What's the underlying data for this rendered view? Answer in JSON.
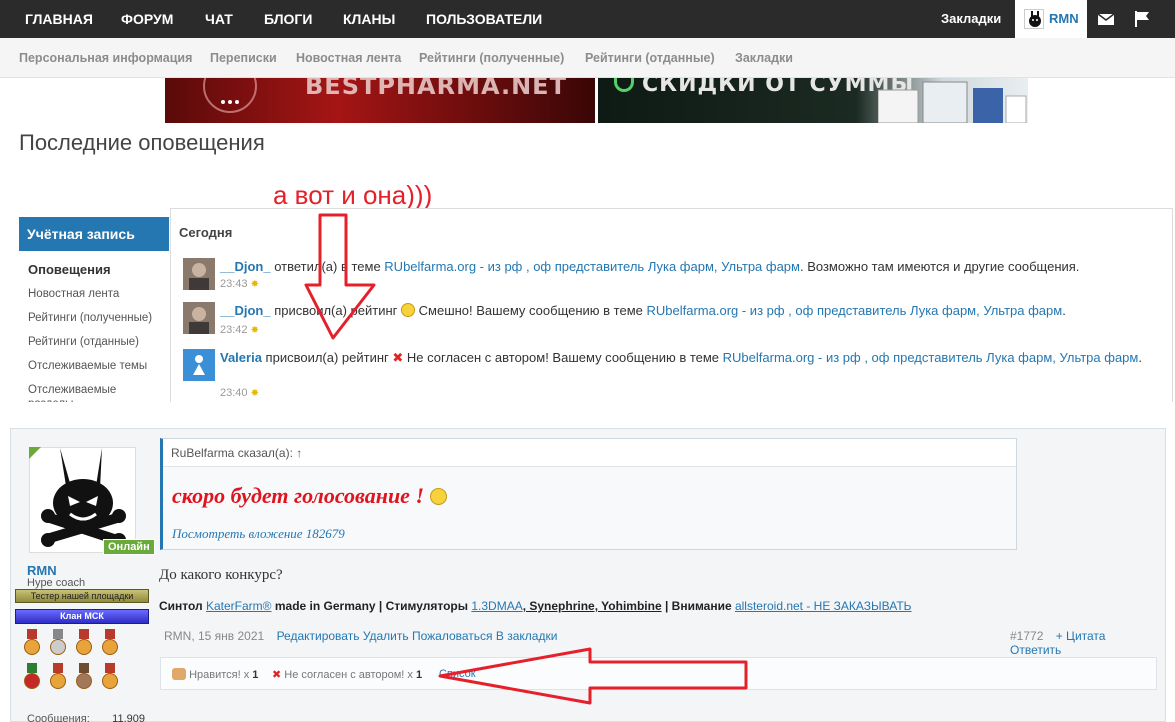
{
  "topnav": {
    "items": [
      "ГЛАВНАЯ",
      "ФОРУМ",
      "ЧАТ",
      "БЛОГИ",
      "КЛАНЫ",
      "ПОЛЬЗОВАТЕЛИ"
    ],
    "bookmarks": "Закладки",
    "username": "RMN",
    "icons": [
      "envelope-icon",
      "flag-icon"
    ]
  },
  "subnav": {
    "items": [
      "Персональная информация",
      "Переписки",
      "Новостная лента",
      "Рейтинги (полученные)",
      "Рейтинги (отданные)",
      "Закладки"
    ]
  },
  "banners": {
    "left_text": "BESTPHARMA.NET",
    "right_text": "СКИДКИ ОТ СУММЫ"
  },
  "page": {
    "title": "Последние оповещения",
    "annotation": "а вот и она)))"
  },
  "sidebar": {
    "header": "Учётная запись",
    "items": [
      "Оповещения",
      "Новостная лента",
      "Рейтинги (полученные)",
      "Рейтинги (отданные)",
      "Отслеживаемые темы",
      "Отслеживаемые разделы"
    ]
  },
  "alerts": {
    "section": "Сегодня",
    "items": [
      {
        "user": "__Djon_",
        "action": " ответил(а) в теме ",
        "thread": "RUbelfarma.org - из рф , оф представитель Лука фарм, Ультра фарм",
        "tail": ". Возможно там имеются и другие сообщения.",
        "time": "23:43"
      },
      {
        "user": "__Djon_",
        "action": " присвоил(а) рейтинг ",
        "rating": " Смешно! Вашему сообщению в теме ",
        "thread": "RUbelfarma.org - из рф , оф представитель Лука фарм, Ультра фарм",
        "tail": ".",
        "time": "23:42"
      },
      {
        "user": "Valeria",
        "action": " присвоил(а) рейтинг ",
        "rating": " Не согласен с автором! Вашему сообщению в теме ",
        "thread": "RUbelfarma.org - из рф , оф представитель Лука фарм, Ультра фарм",
        "tail": ".",
        "time": "23:40"
      }
    ]
  },
  "post": {
    "online": "Онлайн",
    "username": "RMN",
    "usertitle": "Hype coach",
    "badge1": "Тестер нашей площадки",
    "badge2": "Клан МСК",
    "messages_label": "Сообщения:",
    "messages_count": "11,909",
    "quote_head": "RuBelfarma сказал(а): ↑",
    "quote_big": "скоро будет голосование !",
    "quote_link": "Посмотреть вложение 182679",
    "text": "До какого конкурс?",
    "sig": {
      "p1": "Синтол ",
      "p2": "KaterFarm®",
      "p3": " made in Germany | Стимуляторы ",
      "p4": "1.3DMAA",
      "p5": ", Synephrine, Yohimbine",
      "p6": " | Внимание ",
      "p7": "allsteroid.net - НЕ ЗАКАЗЫВАТЬ"
    },
    "meta": "RMN, 15 янв 2021",
    "links": [
      "Редактировать",
      "Удалить",
      "Пожаловаться",
      "В закладки"
    ],
    "number": "#1772",
    "right_links": [
      "+ Цитата",
      "Ответить"
    ],
    "likes": {
      "like_label": "Нравится! x",
      "like_count": "1",
      "dis_label": "Не согласен с автором! x",
      "dis_count": "1",
      "list": "Список"
    }
  },
  "colors": {
    "accent": "#2577b1",
    "nav": "#2b2b2b",
    "annotation": "#e5202a",
    "online": "#6aaa3a"
  }
}
